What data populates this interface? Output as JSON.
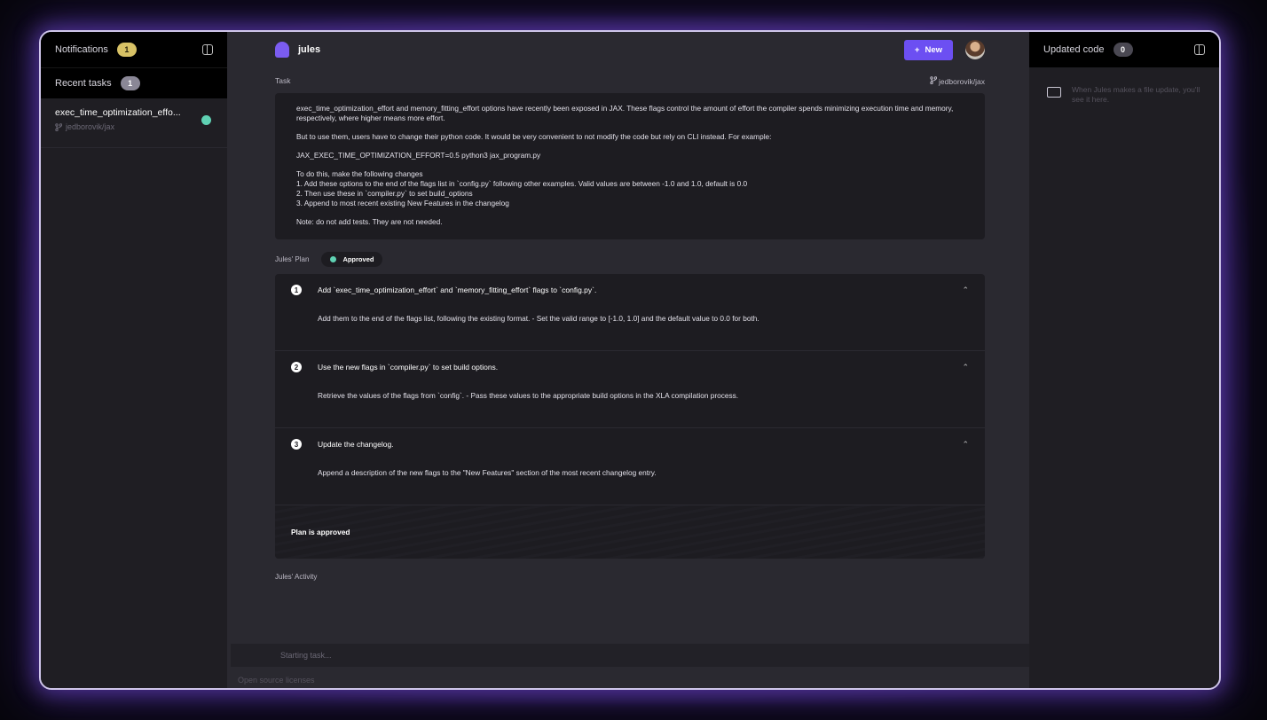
{
  "left": {
    "notifications_label": "Notifications",
    "notifications_count": "1",
    "recent_label": "Recent tasks",
    "recent_count": "1",
    "task": {
      "name": "exec_time_optimization_effo...",
      "repo": "jedborovik/jax"
    }
  },
  "header": {
    "brand": "jules",
    "new_button": "New",
    "new_icon": "+"
  },
  "task": {
    "label": "Task",
    "repo": "jedborovik/jax",
    "paragraphs": [
      "exec_time_optimization_effort and memory_fitting_effort options have recently been exposed in JAX. These flags control the amount of effort the compiler spends minimizing execution time and memory, respectively, where higher means more effort.",
      "But to use them, users have to change their python code. It would be very convenient to not modify the code but rely on CLI instead. For example:",
      "JAX_EXEC_TIME_OPTIMIZATION_EFFORT=0.5 python3 jax_program.py",
      "Note: do not add tests. They are not needed."
    ],
    "changes_intro": "To do this, make the following changes",
    "changes": [
      "1. Add these options to the end of the flags list in `config.py` following other examples. Valid values are between -1.0 and 1.0, default is 0.0",
      "2. Then use these in `compiler.py` to set build_options",
      "3. Append to most recent existing New Features in the changelog"
    ]
  },
  "plan": {
    "label": "Jules' Plan",
    "status": "Approved",
    "steps": [
      {
        "num": "1",
        "title": "Add `exec_time_optimization_effort` and `memory_fitting_effort` flags to `config.py`.",
        "detail": "Add them to the end of the flags list, following the existing format. - Set the valid range to [-1.0, 1.0] and the default value to 0.0 for both."
      },
      {
        "num": "2",
        "title": "Use the new flags in `compiler.py` to set build options.",
        "detail": "Retrieve the values of the flags from `config`. - Pass these values to the appropriate build options in the XLA compilation process."
      },
      {
        "num": "3",
        "title": "Update the changelog.",
        "detail": "Append a description of the new flags to the \"New Features\" section of the most recent changelog entry."
      }
    ],
    "footer": "Plan is approved"
  },
  "activity": {
    "label": "Jules' Activity",
    "status": "Starting task..."
  },
  "footer": {
    "licenses": "Open source licenses"
  },
  "right": {
    "label": "Updated code",
    "count": "0",
    "note": "When Jules makes a file update, you'll see it here."
  }
}
